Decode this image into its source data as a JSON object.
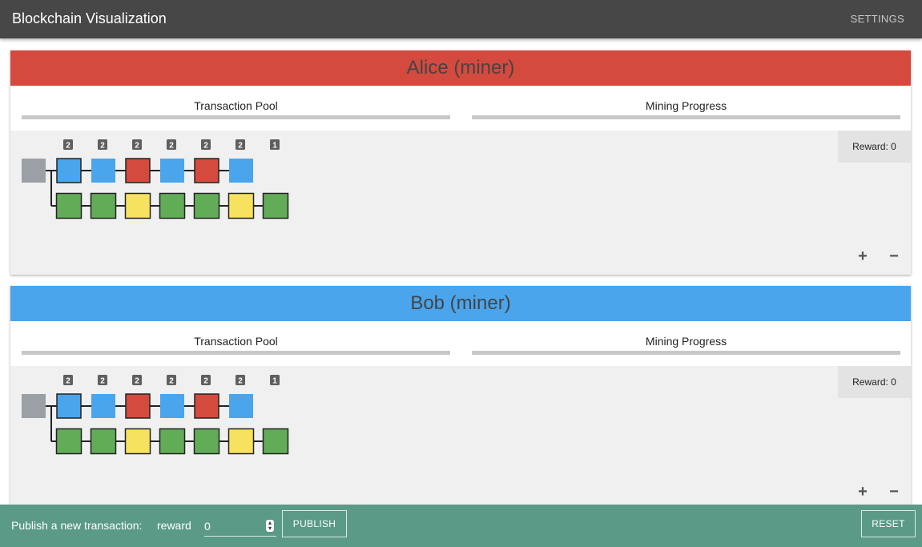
{
  "app": {
    "title": "Blockchain Visualization",
    "settings_label": "SETTINGS"
  },
  "colors": {
    "alice": "#d54a3e",
    "bob": "#4aa5ec",
    "footer": "#5a9a87",
    "topbar": "#474747",
    "block_genesis": "#9aa0a6",
    "block_blue": "#4aa5ec",
    "block_red": "#d54a3e",
    "block_green": "#62ac58",
    "block_yellow": "#f6e25e"
  },
  "panels": [
    {
      "name": "Alice (miner)",
      "header_color": "#d54a3e",
      "pool_label": "Transaction Pool",
      "progress_label": "Mining Progress",
      "reward_text": "Reward: 0",
      "badges": [
        "2",
        "2",
        "2",
        "2",
        "2",
        "2",
        "1"
      ],
      "chain_top": [
        "blue",
        "blue",
        "red",
        "blue",
        "red",
        "blue"
      ],
      "chain_bottom": [
        "green",
        "green",
        "yellow",
        "green",
        "green",
        "yellow",
        "green"
      ],
      "zoom_in": "+",
      "zoom_out": "−"
    },
    {
      "name": "Bob (miner)",
      "header_color": "#4aa5ec",
      "pool_label": "Transaction Pool",
      "progress_label": "Mining Progress",
      "reward_text": "Reward: 0",
      "badges": [
        "2",
        "2",
        "2",
        "2",
        "2",
        "2",
        "1"
      ],
      "chain_top": [
        "blue",
        "blue",
        "red",
        "blue",
        "red",
        "blue"
      ],
      "chain_bottom": [
        "green",
        "green",
        "yellow",
        "green",
        "green",
        "yellow",
        "green"
      ],
      "zoom_in": "+",
      "zoom_out": "−"
    }
  ],
  "footer": {
    "prompt": "Publish a new transaction:",
    "reward_label": "reward",
    "reward_value": "0",
    "publish_label": "PUBLISH",
    "reset_label": "RESET"
  }
}
